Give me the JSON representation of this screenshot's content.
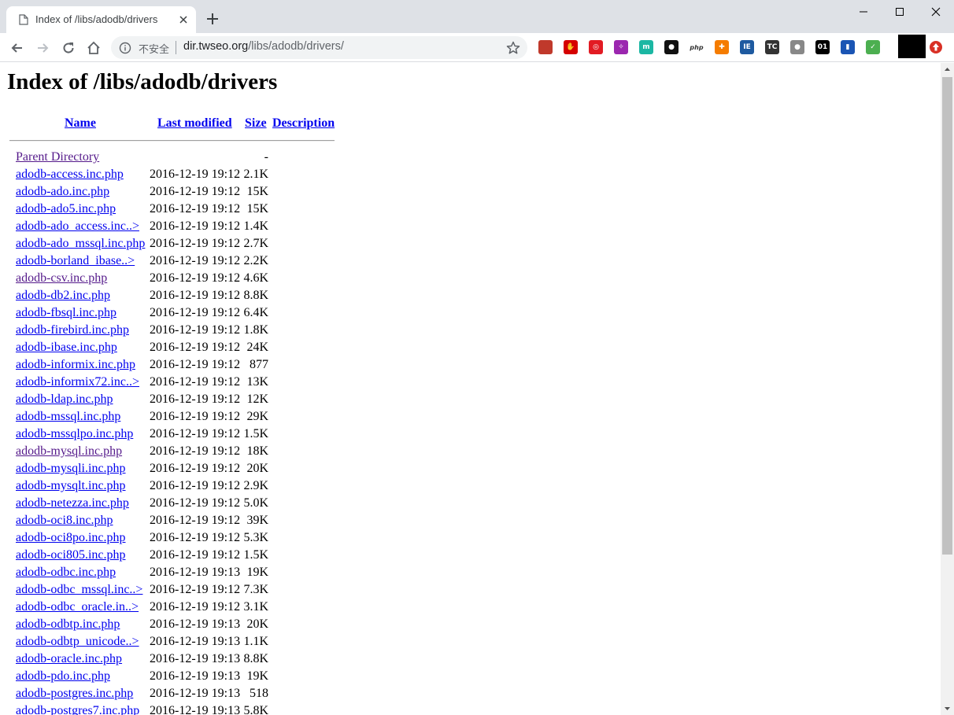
{
  "browser": {
    "tab_title": "Index of /libs/adodb/drivers",
    "security_label": "不安全",
    "url_host": "dir.twseo.org",
    "url_path": "/libs/adodb/drivers/",
    "icons": {
      "favicon": "document-icon",
      "tab_close": "close-icon",
      "new_tab": "plus-icon",
      "back": "arrow-left-icon",
      "forward": "arrow-right-icon",
      "reload": "reload-icon",
      "home": "home-icon",
      "info": "info-icon",
      "bookmark": "star-icon"
    },
    "extensions": [
      {
        "name": "book-extension-icon",
        "color": "#c0392b",
        "glyph": ""
      },
      {
        "name": "adblock-extension-icon",
        "color": "#d50000",
        "glyph": "✋"
      },
      {
        "name": "swirl-extension-icon",
        "color": "#e21b23",
        "glyph": "◎"
      },
      {
        "name": "puzzle-extension-icon",
        "color": "#9b27af",
        "glyph": "✧"
      },
      {
        "name": "m-extension-icon",
        "color": "#1bb7a3",
        "glyph": "m"
      },
      {
        "name": "ghost-extension-icon",
        "color": "#111111",
        "glyph": "●"
      },
      {
        "name": "php-extension-icon",
        "color": "#ffffff",
        "glyph": "php"
      },
      {
        "name": "orange-extension-icon",
        "color": "#f57c00",
        "glyph": "✚"
      },
      {
        "name": "ie-extension-icon",
        "color": "#1e5aa0",
        "glyph": "IE"
      },
      {
        "name": "tc-extension-icon",
        "color": "#333333",
        "glyph": "TC"
      },
      {
        "name": "gray-extension-icon",
        "color": "#888888",
        "glyph": "●"
      },
      {
        "name": "o1-extension-icon",
        "color": "#000000",
        "glyph": "01"
      },
      {
        "name": "bookmark-extension-icon",
        "color": "#1a55b4",
        "glyph": "▮"
      },
      {
        "name": "inbox-extension-icon",
        "color": "#4caf50",
        "glyph": "✓"
      }
    ]
  },
  "page": {
    "heading": "Index of /libs/adodb/drivers",
    "columns": {
      "name": "Name",
      "modified": "Last modified",
      "size": "Size",
      "description": "Description"
    },
    "parent": {
      "name": "Parent Directory",
      "size": "-"
    },
    "files": [
      {
        "name": "adodb-access.inc.php",
        "modified": "2016-12-19 19:12",
        "size": "2.1K",
        "visited": false
      },
      {
        "name": "adodb-ado.inc.php",
        "modified": "2016-12-19 19:12",
        "size": "15K",
        "visited": false
      },
      {
        "name": "adodb-ado5.inc.php",
        "modified": "2016-12-19 19:12",
        "size": "15K",
        "visited": false
      },
      {
        "name": "adodb-ado_access.inc..>",
        "modified": "2016-12-19 19:12",
        "size": "1.4K",
        "visited": false
      },
      {
        "name": "adodb-ado_mssql.inc.php",
        "modified": "2016-12-19 19:12",
        "size": "2.7K",
        "visited": false
      },
      {
        "name": "adodb-borland_ibase..>",
        "modified": "2016-12-19 19:12",
        "size": "2.2K",
        "visited": false
      },
      {
        "name": "adodb-csv.inc.php",
        "modified": "2016-12-19 19:12",
        "size": "4.6K",
        "visited": true
      },
      {
        "name": "adodb-db2.inc.php",
        "modified": "2016-12-19 19:12",
        "size": "8.8K",
        "visited": false
      },
      {
        "name": "adodb-fbsql.inc.php",
        "modified": "2016-12-19 19:12",
        "size": "6.4K",
        "visited": false
      },
      {
        "name": "adodb-firebird.inc.php",
        "modified": "2016-12-19 19:12",
        "size": "1.8K",
        "visited": false
      },
      {
        "name": "adodb-ibase.inc.php",
        "modified": "2016-12-19 19:12",
        "size": "24K",
        "visited": false
      },
      {
        "name": "adodb-informix.inc.php",
        "modified": "2016-12-19 19:12",
        "size": "877",
        "visited": false
      },
      {
        "name": "adodb-informix72.inc..>",
        "modified": "2016-12-19 19:12",
        "size": "13K",
        "visited": false
      },
      {
        "name": "adodb-ldap.inc.php",
        "modified": "2016-12-19 19:12",
        "size": "12K",
        "visited": false
      },
      {
        "name": "adodb-mssql.inc.php",
        "modified": "2016-12-19 19:12",
        "size": "29K",
        "visited": false
      },
      {
        "name": "adodb-mssqlpo.inc.php",
        "modified": "2016-12-19 19:12",
        "size": "1.5K",
        "visited": false
      },
      {
        "name": "adodb-mysql.inc.php",
        "modified": "2016-12-19 19:12",
        "size": "18K",
        "visited": true
      },
      {
        "name": "adodb-mysqli.inc.php",
        "modified": "2016-12-19 19:12",
        "size": "20K",
        "visited": false
      },
      {
        "name": "adodb-mysqlt.inc.php",
        "modified": "2016-12-19 19:12",
        "size": "2.9K",
        "visited": false
      },
      {
        "name": "adodb-netezza.inc.php",
        "modified": "2016-12-19 19:12",
        "size": "5.0K",
        "visited": false
      },
      {
        "name": "adodb-oci8.inc.php",
        "modified": "2016-12-19 19:12",
        "size": "39K",
        "visited": false
      },
      {
        "name": "adodb-oci8po.inc.php",
        "modified": "2016-12-19 19:12",
        "size": "5.3K",
        "visited": false
      },
      {
        "name": "adodb-oci805.inc.php",
        "modified": "2016-12-19 19:12",
        "size": "1.5K",
        "visited": false
      },
      {
        "name": "adodb-odbc.inc.php",
        "modified": "2016-12-19 19:13",
        "size": "19K",
        "visited": false
      },
      {
        "name": "adodb-odbc_mssql.inc..>",
        "modified": "2016-12-19 19:12",
        "size": "7.3K",
        "visited": false
      },
      {
        "name": "adodb-odbc_oracle.in..>",
        "modified": "2016-12-19 19:12",
        "size": "3.1K",
        "visited": false
      },
      {
        "name": "adodb-odbtp.inc.php",
        "modified": "2016-12-19 19:13",
        "size": "20K",
        "visited": false
      },
      {
        "name": "adodb-odbtp_unicode..>",
        "modified": "2016-12-19 19:13",
        "size": "1.1K",
        "visited": false
      },
      {
        "name": "adodb-oracle.inc.php",
        "modified": "2016-12-19 19:13",
        "size": "8.8K",
        "visited": false
      },
      {
        "name": "adodb-pdo.inc.php",
        "modified": "2016-12-19 19:13",
        "size": "19K",
        "visited": false
      },
      {
        "name": "adodb-postgres.inc.php",
        "modified": "2016-12-19 19:13",
        "size": "518",
        "visited": false
      },
      {
        "name": "adodb-postgres7.inc.php",
        "modified": "2016-12-19 19:13",
        "size": "5.8K",
        "visited": false
      }
    ]
  }
}
